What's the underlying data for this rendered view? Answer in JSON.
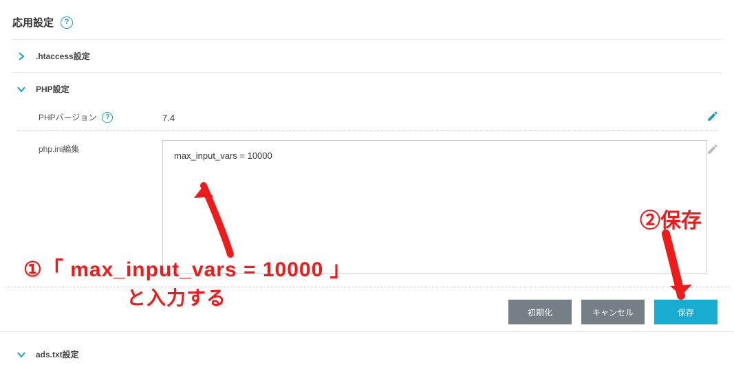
{
  "title": "応用設定",
  "sections": {
    "htaccess": {
      "label": ".htaccess設定"
    },
    "php": {
      "label": "PHP設定",
      "version_label": "PHPバージョン",
      "version_value": "7.4",
      "ini_label": "php.ini編集",
      "ini_value": "max_input_vars = 10000"
    },
    "ads": {
      "label": "ads.txt設定"
    }
  },
  "buttons": {
    "reset": "初期化",
    "cancel": "キャンセル",
    "save": "保存"
  },
  "annotations": {
    "step1_line1": "①「 max_input_vars = 10000 」",
    "step1_line2": "と入力する",
    "step2": "②保存"
  }
}
